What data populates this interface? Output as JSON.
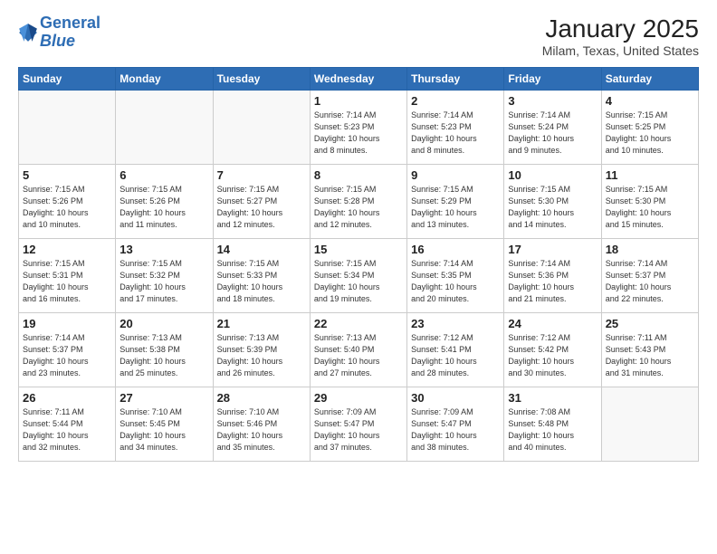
{
  "header": {
    "logo_line1": "General",
    "logo_line2": "Blue",
    "month": "January 2025",
    "location": "Milam, Texas, United States"
  },
  "weekdays": [
    "Sunday",
    "Monday",
    "Tuesday",
    "Wednesday",
    "Thursday",
    "Friday",
    "Saturday"
  ],
  "weeks": [
    [
      {
        "day": "",
        "info": ""
      },
      {
        "day": "",
        "info": ""
      },
      {
        "day": "",
        "info": ""
      },
      {
        "day": "1",
        "info": "Sunrise: 7:14 AM\nSunset: 5:23 PM\nDaylight: 10 hours\nand 8 minutes."
      },
      {
        "day": "2",
        "info": "Sunrise: 7:14 AM\nSunset: 5:23 PM\nDaylight: 10 hours\nand 8 minutes."
      },
      {
        "day": "3",
        "info": "Sunrise: 7:14 AM\nSunset: 5:24 PM\nDaylight: 10 hours\nand 9 minutes."
      },
      {
        "day": "4",
        "info": "Sunrise: 7:15 AM\nSunset: 5:25 PM\nDaylight: 10 hours\nand 10 minutes."
      }
    ],
    [
      {
        "day": "5",
        "info": "Sunrise: 7:15 AM\nSunset: 5:26 PM\nDaylight: 10 hours\nand 10 minutes."
      },
      {
        "day": "6",
        "info": "Sunrise: 7:15 AM\nSunset: 5:26 PM\nDaylight: 10 hours\nand 11 minutes."
      },
      {
        "day": "7",
        "info": "Sunrise: 7:15 AM\nSunset: 5:27 PM\nDaylight: 10 hours\nand 12 minutes."
      },
      {
        "day": "8",
        "info": "Sunrise: 7:15 AM\nSunset: 5:28 PM\nDaylight: 10 hours\nand 12 minutes."
      },
      {
        "day": "9",
        "info": "Sunrise: 7:15 AM\nSunset: 5:29 PM\nDaylight: 10 hours\nand 13 minutes."
      },
      {
        "day": "10",
        "info": "Sunrise: 7:15 AM\nSunset: 5:30 PM\nDaylight: 10 hours\nand 14 minutes."
      },
      {
        "day": "11",
        "info": "Sunrise: 7:15 AM\nSunset: 5:30 PM\nDaylight: 10 hours\nand 15 minutes."
      }
    ],
    [
      {
        "day": "12",
        "info": "Sunrise: 7:15 AM\nSunset: 5:31 PM\nDaylight: 10 hours\nand 16 minutes."
      },
      {
        "day": "13",
        "info": "Sunrise: 7:15 AM\nSunset: 5:32 PM\nDaylight: 10 hours\nand 17 minutes."
      },
      {
        "day": "14",
        "info": "Sunrise: 7:15 AM\nSunset: 5:33 PM\nDaylight: 10 hours\nand 18 minutes."
      },
      {
        "day": "15",
        "info": "Sunrise: 7:15 AM\nSunset: 5:34 PM\nDaylight: 10 hours\nand 19 minutes."
      },
      {
        "day": "16",
        "info": "Sunrise: 7:14 AM\nSunset: 5:35 PM\nDaylight: 10 hours\nand 20 minutes."
      },
      {
        "day": "17",
        "info": "Sunrise: 7:14 AM\nSunset: 5:36 PM\nDaylight: 10 hours\nand 21 minutes."
      },
      {
        "day": "18",
        "info": "Sunrise: 7:14 AM\nSunset: 5:37 PM\nDaylight: 10 hours\nand 22 minutes."
      }
    ],
    [
      {
        "day": "19",
        "info": "Sunrise: 7:14 AM\nSunset: 5:37 PM\nDaylight: 10 hours\nand 23 minutes."
      },
      {
        "day": "20",
        "info": "Sunrise: 7:13 AM\nSunset: 5:38 PM\nDaylight: 10 hours\nand 25 minutes."
      },
      {
        "day": "21",
        "info": "Sunrise: 7:13 AM\nSunset: 5:39 PM\nDaylight: 10 hours\nand 26 minutes."
      },
      {
        "day": "22",
        "info": "Sunrise: 7:13 AM\nSunset: 5:40 PM\nDaylight: 10 hours\nand 27 minutes."
      },
      {
        "day": "23",
        "info": "Sunrise: 7:12 AM\nSunset: 5:41 PM\nDaylight: 10 hours\nand 28 minutes."
      },
      {
        "day": "24",
        "info": "Sunrise: 7:12 AM\nSunset: 5:42 PM\nDaylight: 10 hours\nand 30 minutes."
      },
      {
        "day": "25",
        "info": "Sunrise: 7:11 AM\nSunset: 5:43 PM\nDaylight: 10 hours\nand 31 minutes."
      }
    ],
    [
      {
        "day": "26",
        "info": "Sunrise: 7:11 AM\nSunset: 5:44 PM\nDaylight: 10 hours\nand 32 minutes."
      },
      {
        "day": "27",
        "info": "Sunrise: 7:10 AM\nSunset: 5:45 PM\nDaylight: 10 hours\nand 34 minutes."
      },
      {
        "day": "28",
        "info": "Sunrise: 7:10 AM\nSunset: 5:46 PM\nDaylight: 10 hours\nand 35 minutes."
      },
      {
        "day": "29",
        "info": "Sunrise: 7:09 AM\nSunset: 5:47 PM\nDaylight: 10 hours\nand 37 minutes."
      },
      {
        "day": "30",
        "info": "Sunrise: 7:09 AM\nSunset: 5:47 PM\nDaylight: 10 hours\nand 38 minutes."
      },
      {
        "day": "31",
        "info": "Sunrise: 7:08 AM\nSunset: 5:48 PM\nDaylight: 10 hours\nand 40 minutes."
      },
      {
        "day": "",
        "info": ""
      }
    ]
  ]
}
